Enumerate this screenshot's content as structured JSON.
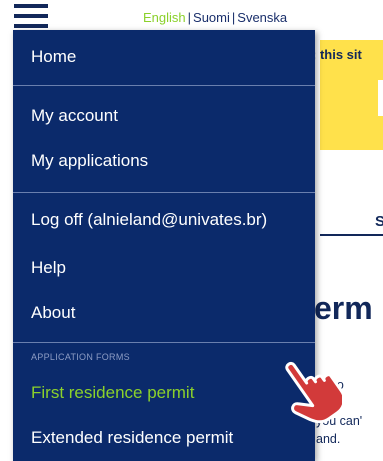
{
  "header": {
    "languages": [
      "English",
      "Suomi",
      "Svenska"
    ],
    "separator": "|"
  },
  "background_page": {
    "notice_text": "; this sit",
    "tab_label": "S",
    "heading": "erm",
    "paragraph": "nn to\n ant\nyou can'\nand."
  },
  "menu": {
    "home": "Home",
    "my_account": "My account",
    "my_applications": "My applications",
    "log_off": "Log off (alnieland@univates.br)",
    "help": "Help",
    "about": "About",
    "section_label": "APPLICATION FORMS",
    "first_residence_permit": "First residence permit",
    "extended_residence_permit": "Extended residence permit"
  },
  "colors": {
    "menu_bg": "#0b2a6b",
    "accent_green": "#8bd12b",
    "notice_yellow": "#ffe14b",
    "brand_navy": "#12285a"
  },
  "icons": {
    "menu_toggle": "hamburger-icon",
    "cursor": "hand-pointer-icon"
  }
}
